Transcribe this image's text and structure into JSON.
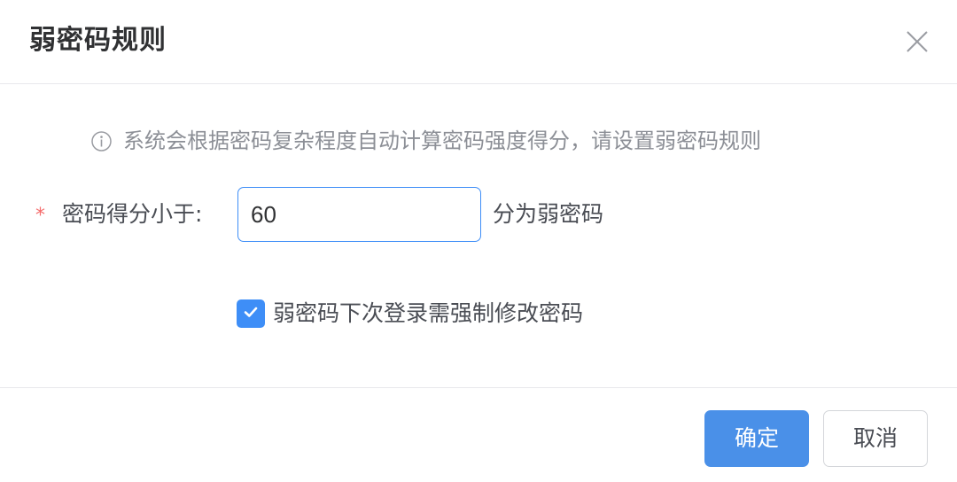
{
  "dialog": {
    "title": "弱密码规则",
    "hint": "系统会根据密码复杂程度自动计算密码强度得分，请设置弱密码规则",
    "form": {
      "required_mark": "*",
      "label": "密码得分小于:",
      "value": "60",
      "suffix": "分为弱密码"
    },
    "checkbox": {
      "checked": true,
      "label": "弱密码下次登录需强制修改密码"
    },
    "buttons": {
      "confirm": "确定",
      "cancel": "取消"
    }
  },
  "icons": {
    "close": "close-icon",
    "info": "info-icon",
    "check": "check-icon"
  },
  "colors": {
    "primary": "#4a90e8",
    "input_border": "#3e8ef7",
    "required": "#f56c6c",
    "text": "#4a4d54",
    "muted": "#8c8f96"
  }
}
